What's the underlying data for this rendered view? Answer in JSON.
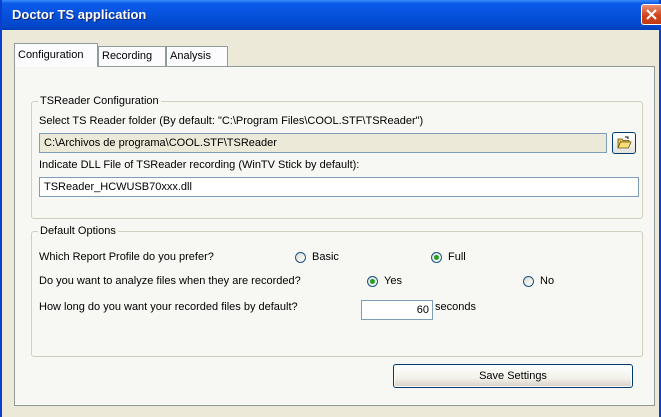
{
  "window": {
    "title": "Doctor TS application",
    "close_icon": "close-icon"
  },
  "tabs": [
    {
      "label": "Configuration",
      "active": true
    },
    {
      "label": "Recording",
      "active": false
    },
    {
      "label": "Analysis",
      "active": false
    }
  ],
  "tsreader": {
    "legend": "TSReader Configuration",
    "folder_label": "Select TS Reader folder (By default: \"C:\\Program Files\\COOL.STF\\TSReader\")",
    "folder_value": "C:\\Archivos de programa\\COOL.STF\\TSReader",
    "browse_icon": "open-folder-icon",
    "dll_label": "Indicate DLL File of TSReader recording (WinTV Stick by default):",
    "dll_value": "TSReader_HCWUSB70xxx.dll"
  },
  "defaults": {
    "legend": "Default Options",
    "report_question": "Which Report Profile do you prefer?",
    "report_options": [
      {
        "label": "Basic",
        "selected": false
      },
      {
        "label": "Full",
        "selected": true
      }
    ],
    "analyze_question": "Do you want to analyze files when they are recorded?",
    "analyze_options": [
      {
        "label": "Yes",
        "selected": true
      },
      {
        "label": "No",
        "selected": false
      }
    ],
    "duration_question": "How long do you want your recorded files by default?",
    "duration_value": "60",
    "duration_unit": "seconds"
  },
  "save_label": "Save Settings",
  "colors": {
    "titlebar": "#0552dc",
    "window_bg": "#ece9d8",
    "close": "#d3431c",
    "radio_on": "#21a121"
  }
}
